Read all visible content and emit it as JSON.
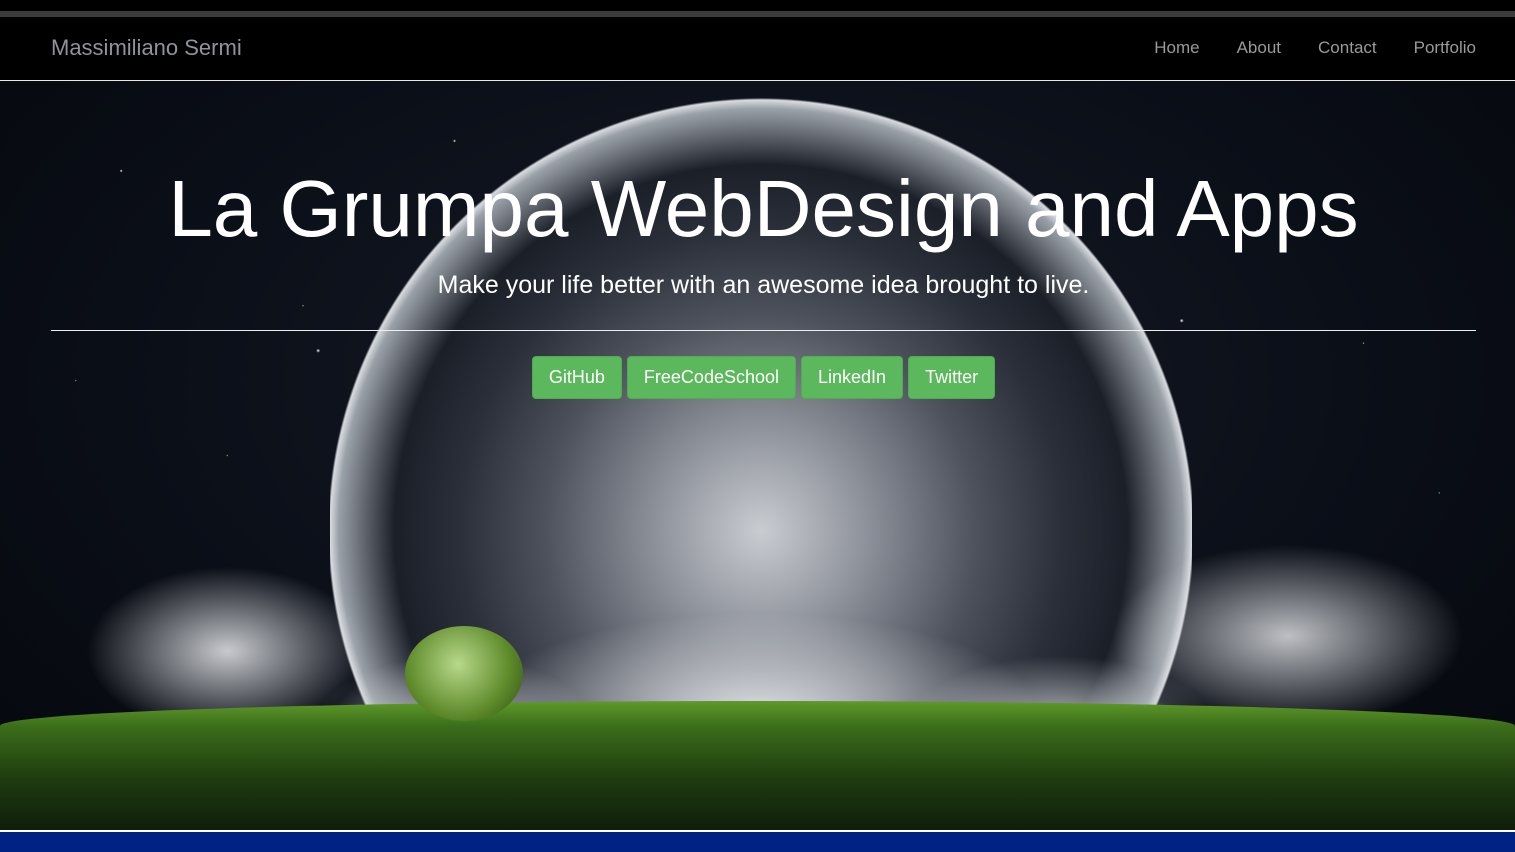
{
  "nav": {
    "brand": "Massimiliano Sermi",
    "items": [
      {
        "label": "Home"
      },
      {
        "label": "About"
      },
      {
        "label": "Contact"
      },
      {
        "label": "Portfolio"
      }
    ]
  },
  "hero": {
    "title": "La Grumpa WebDesign and Apps",
    "subtitle": "Make your life better with an awesome idea brought to live.",
    "buttons": [
      {
        "label": "GitHub"
      },
      {
        "label": "FreeCodeSchool"
      },
      {
        "label": "LinkedIn"
      },
      {
        "label": "Twitter"
      }
    ],
    "button_color": "#5cb85c"
  },
  "footer": {
    "color": "#002383"
  }
}
